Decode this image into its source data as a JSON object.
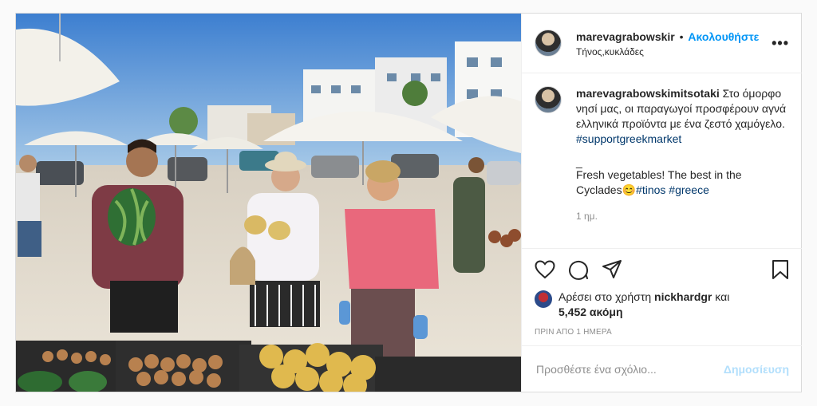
{
  "header": {
    "username": "marevagrabowskir",
    "separator": "•",
    "follow_label": "Ακολουθήστε",
    "location": "Τήνος,κυκλάδες",
    "more_label": "•••"
  },
  "caption": {
    "username": "marevagrabowskimitsotaki",
    "text_greek": "Στο όμορφο νησί μας, οι παραγωγοί προσφέρουν αγνά ελληνικά προϊόντα με ένα ζεστό χαμόγελο.",
    "hashtag_support": "#supportgreekmarket",
    "dash": "_",
    "text_english": "Fresh vegetables! The best in the Cyclades",
    "emoji": "😊",
    "hashtag_tinos": "#tinos",
    "hashtag_greece": "#greece",
    "age": "1 ημ."
  },
  "actions": {
    "like_icon": "heart-icon",
    "comment_icon": "comment-icon",
    "share_icon": "send-icon",
    "save_icon": "bookmark-icon"
  },
  "likes": {
    "prefix": "Αρέσει στο χρήστη",
    "user": "nickhardgr",
    "conj": "και",
    "count": "5,452 ακόμη"
  },
  "timestamp": "ΠΡΙΝ ΑΠΟ 1 ΗΜΕΡΑ",
  "comment": {
    "placeholder": "Προσθέστε ένα σχόλιο...",
    "publish_label": "Δημοσίευση"
  },
  "colors": {
    "accent": "#0095f6",
    "publish_disabled": "#b2dffc",
    "hashtag": "#00376b",
    "muted": "#8e8e8e"
  }
}
